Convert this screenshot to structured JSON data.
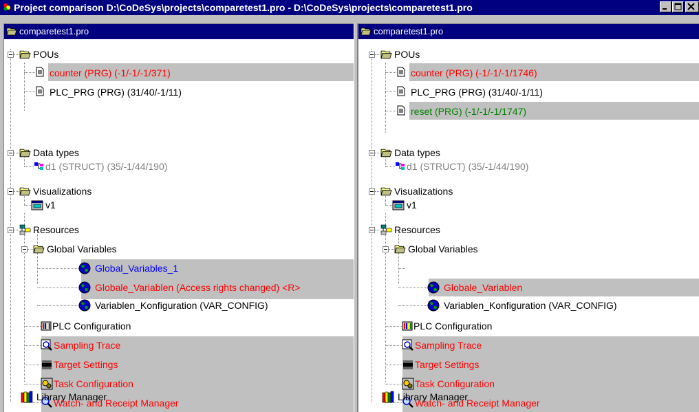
{
  "window": {
    "title": "Project comparison D:\\CoDeSys\\projects\\comparetest1.pro - D:\\CoDeSys\\projects\\comparetest1.pro"
  },
  "left": {
    "header": "comparetest1.pro",
    "pous": "POUs",
    "pou_items": [
      {
        "label": "counter (PRG) (-1/-1/-1/371)",
        "color": "#ff0000"
      },
      {
        "label": "PLC_PRG (PRG) (31/40/-1/11)",
        "color": "#000000"
      }
    ],
    "data_types": "Data types",
    "dt_item": "d1 (STRUCT) (35/-1/44/190)",
    "visualizations": "Visualizations",
    "vis_item": "v1",
    "resources": "Resources",
    "global_variables": "Global Variables",
    "gv_items": [
      {
        "label": "Global_Variables_1",
        "color": "#0000ff"
      },
      {
        "label": "Globale_Variablen (Access rights changed) <R>",
        "color": "#ff0000"
      },
      {
        "label": "Variablen_Konfiguration (VAR_CONFIG)",
        "color": "#000000"
      }
    ],
    "plc_config": "PLC Configuration",
    "sampling_trace": "Sampling Trace",
    "target_settings": "Target Settings",
    "task_config": "Task Configuration",
    "watch_manager": "Watch- and Receipt Manager",
    "library_manager": "Library Manager"
  },
  "right": {
    "header": "comparetest1.pro",
    "pous": "POUs",
    "pou_items": [
      {
        "label": "counter (PRG) (-1/-1/-1/1746)",
        "color": "#ff0000"
      },
      {
        "label": "PLC_PRG (PRG) (31/40/-1/11)",
        "color": "#000000"
      },
      {
        "label": "reset (PRG) (-1/-1/-1/1747)",
        "color": "#008000"
      }
    ],
    "data_types": "Data types",
    "dt_item": "d1 (STRUCT) (35/-1/44/190)",
    "visualizations": "Visualizations",
    "vis_item": "v1",
    "resources": "Resources",
    "global_variables": "Global Variables",
    "gv_items": [
      {
        "label": "Globale_Variablen",
        "color": "#ff0000"
      },
      {
        "label": "Variablen_Konfiguration (VAR_CONFIG)",
        "color": "#000000"
      }
    ],
    "plc_config": "PLC Configuration",
    "sampling_trace": "Sampling Trace",
    "target_settings": "Target Settings",
    "task_config": "Task Configuration",
    "watch_manager": "Watch- and Receipt Manager",
    "library_manager": "Library Manager"
  },
  "colors": {
    "titlebar": "#000080",
    "highlight": "#c0c0c0",
    "changed": "#ff0000",
    "added": "#008000",
    "only_left": "#0000ff",
    "unchanged_gray": "#808080"
  }
}
